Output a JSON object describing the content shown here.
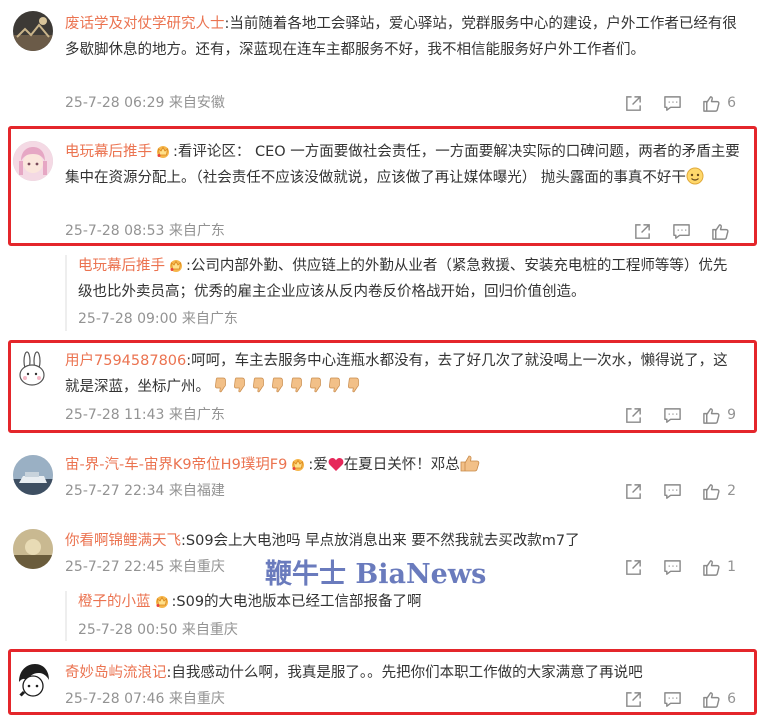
{
  "comments": [
    {
      "user": "废话学及对仗学研究人士",
      "text": ":当前随着各地工会驿站，爱心驿站，党群服务中心的建设，户外工作者已经有很多歇脚休息的地方。还有，深蓝现在连车主都服务不好，我不相信能服务好户外工作者们。",
      "meta": "25-7-28 06:29 来自安徽",
      "likes": "6"
    },
    {
      "user": "电玩幕后推手",
      "text": ":看评论区： CEO 一方面要做社会责任，一方面要解决实际的口碑问题，两者的矛盾主要集中在资源分配上。（社会责任不应该没做就说，应该做了再让媒体曝光） 抛头露面的事真不好干",
      "meta": "25-7-28 08:53 来自广东",
      "likes": ""
    },
    {
      "user": "电玩幕后推手",
      "text": ":公司内部外勤、供应链上的外勤从业者（紧急救援、安装充电桩的工程师等等）优先级也比外卖员高；优秀的雇主企业应该从反内卷反价格战开始，回归价值创造。",
      "meta": "25-7-28 09:00 来自广东",
      "likes": ""
    },
    {
      "user": "用户7594587806",
      "text": ":呵呵，车主去服务中心连瓶水都没有，去了好几次了就没喝上一次水，懒得说了，这就是深蓝，坐标广州。",
      "meta": "25-7-28 11:43 来自广东",
      "likes": "9"
    },
    {
      "user": "宙-界-汽-车-宙界K9帝位H9璞玥F9",
      "text": ":爱",
      "text2": "在夏日关怀！邓总",
      "meta": "25-7-27 22:34 来自福建",
      "likes": "2"
    },
    {
      "user": "你看啊锦鲤满天飞",
      "text": ":S09会上大电池吗 早点放消息出来 要不然我就去买改款m7了",
      "meta": "25-7-27 22:45 来自重庆",
      "likes": "1"
    },
    {
      "user": "橙子的小蓝",
      "text": ":S09的大电池版本已经工信部报备了啊",
      "meta": "25-7-28 00:50 来自重庆",
      "likes": ""
    },
    {
      "user": "奇妙岛屿流浪记",
      "text": ":自我感动什么啊，我真是服了。。先把你们本职工作做的大家满意了再说吧",
      "meta": "25-7-28 07:46 来自重庆",
      "likes": "6"
    }
  ],
  "watermark": "鞭牛士 BiaNews",
  "colors": {
    "username": "#eb7350",
    "meta": "#939393",
    "highlight": "#e4262b",
    "text": "#333333"
  },
  "icons": [
    "share-icon",
    "comment-icon",
    "like-icon",
    "crown-vip-icon",
    "heart-icon",
    "thumbs-up-emoji",
    "thumbs-down-emoji",
    "smile-emoji"
  ]
}
